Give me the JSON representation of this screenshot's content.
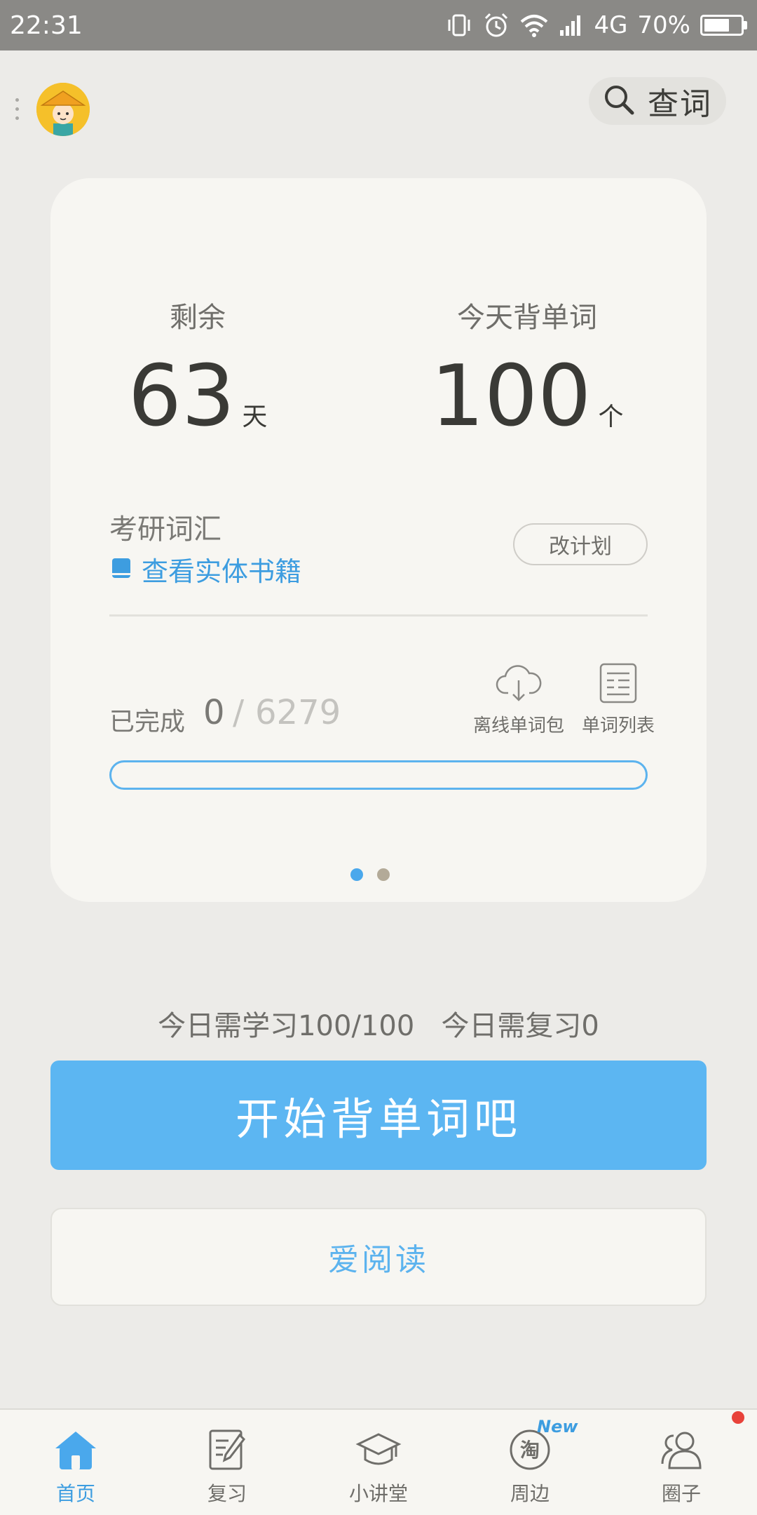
{
  "status_bar": {
    "time": "22:31",
    "network": "4G",
    "battery": "70%",
    "battery_level": 0.7
  },
  "top_bar": {
    "avatar_icon": "farmer-avatar",
    "search_label": "查词",
    "search_icon": "search-icon"
  },
  "plan_card": {
    "remaining_label": "剩余",
    "remaining_value": "63",
    "remaining_unit": "天",
    "daily_label": "今天背单词",
    "daily_value": "100",
    "daily_unit": "个",
    "book_name": "考研词汇",
    "book_link": "查看实体书籍",
    "change_plan": "改计划",
    "progress_label": "已完成",
    "progress_done": "0",
    "progress_sep": "/",
    "progress_total": "6279",
    "progress_fraction": 0.0,
    "offline_pack": "离线单词包",
    "word_list": "单词列表",
    "pages_total": 2,
    "page_active": 1
  },
  "daily_summary": {
    "learn": "今日需学习100/100",
    "review": "今日需复习0"
  },
  "actions": {
    "start": "开始背单词吧",
    "reading": "爱阅读"
  },
  "bottom_nav": {
    "items": [
      {
        "label": "首页",
        "icon": "home-icon",
        "active": true
      },
      {
        "label": "复习",
        "icon": "review-icon"
      },
      {
        "label": "小讲堂",
        "icon": "graduation-cap-icon"
      },
      {
        "label": "周边",
        "icon": "taobao-icon",
        "badge": "New"
      },
      {
        "label": "圈子",
        "icon": "people-icon",
        "dot": true
      }
    ]
  },
  "colors": {
    "accent": "#5cb6f2",
    "link": "#3d9de0",
    "background": "#ecebe8",
    "card": "#f7f6f2",
    "status_bar": "#8a8986",
    "notification_dot": "#e8423a"
  }
}
